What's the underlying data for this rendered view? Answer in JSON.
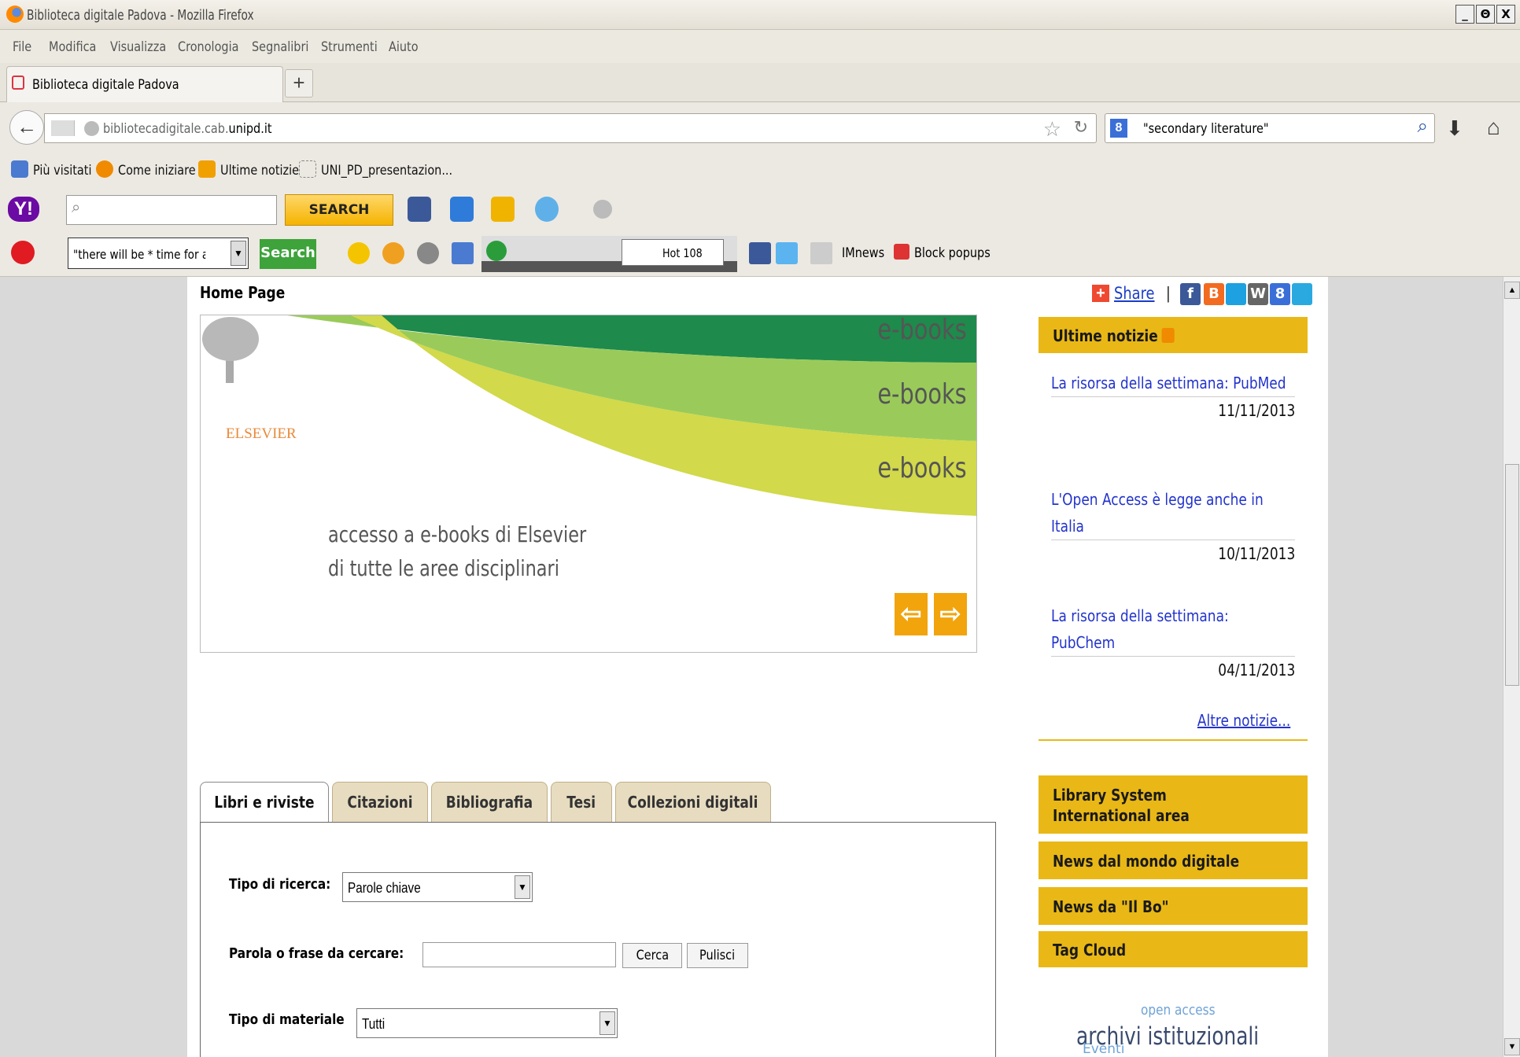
{
  "window": {
    "title": "Biblioteca digitale Padova - Mozilla Firefox",
    "controls": [
      "_",
      "Θ",
      "X"
    ]
  },
  "menu": [
    "File",
    "Modifica",
    "Visualizza",
    "Cronologia",
    "Segnalibri",
    "Strumenti",
    "Aiuto"
  ],
  "tab": {
    "label": "Biblioteca digitale Padova",
    "new_tab": "+"
  },
  "nav": {
    "url_prefix": "bibliotecadigitale.cab.",
    "url_domain": "unipd.it",
    "search_query": "\"secondary literature\"",
    "search_engine": "8"
  },
  "bookmarks": [
    "Più visitati",
    "Come iniziare",
    "Ultime notizie",
    "UNI_PD_presentazion..."
  ],
  "yahoo": {
    "logo": "Y!",
    "search_label": "SEARCH"
  },
  "toolbar2": {
    "query": "\"there will be * time for a hund",
    "search_label": "Search",
    "hot_value": "Hot 108",
    "imnews": "IMnews",
    "block_popups": "Block popups"
  },
  "page": {
    "title": "Home Page",
    "slider": {
      "brand": "ELSEVIER",
      "ebook_words": [
        "e-books",
        "e-books",
        "e-books"
      ],
      "caption_line1": "accesso a e-books di Elsevier",
      "caption_line2": "di tutte le aree disciplinari",
      "prev": "⇦",
      "next": "⇨"
    },
    "tabs": [
      "Libri e riviste",
      "Citazioni",
      "Bibliografia",
      "Tesi",
      "Collezioni digitali"
    ],
    "form": {
      "tipo_ricerca_label": "Tipo di ricerca:",
      "tipo_ricerca_value": "Parole chiave",
      "parola_label": "Parola o frase da cercare:",
      "parola_value": "",
      "cerca": "Cerca",
      "pulisci": "Pulisci",
      "materiale_label": "Tipo di materiale",
      "materiale_value": "Tutti"
    }
  },
  "sidebar": {
    "share": "Share",
    "news_heading": "Ultime notizie",
    "news": [
      {
        "title": "La risorsa della settimana: PubMed",
        "date": "11/11/2013"
      },
      {
        "title": "L'Open Access è legge anche in Italia",
        "date": "10/11/2013"
      },
      {
        "title": "La risorsa della settimana: PubChem",
        "date": "04/11/2013"
      }
    ],
    "more_news": "Altre notizie...",
    "boxes": [
      "Library System International area",
      "News dal mondo digitale",
      "News da \"Il Bo\"",
      "Tag Cloud"
    ],
    "oa_small": "open access",
    "oa_big": "archivi istituzionali",
    "oa_under": "Eventi"
  },
  "colors": {
    "accent": "#e9b816",
    "link": "#2233cc",
    "slider_orange": "#f2a40d"
  }
}
